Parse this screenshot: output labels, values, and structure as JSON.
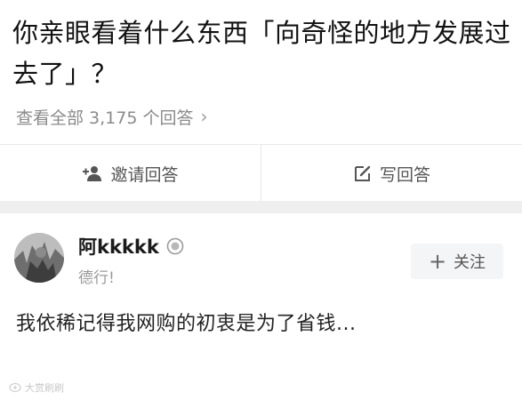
{
  "question": {
    "title": "你亲眼看着什么东西「向奇怪的地方发展过去了」？",
    "all_answers_label": "查看全部 3,175 个回答",
    "chevron": "›"
  },
  "actions": {
    "invite_label": "邀请回答",
    "invite_icon": "person-add-icon",
    "write_label": "写回答",
    "write_icon": "edit-icon"
  },
  "answer": {
    "author_name": "阿kkkkk",
    "author_bio": "德行!",
    "follow_label": "关注",
    "follow_plus": "+",
    "excerpt": "我依稀记得我网购的初衷是为了省钱..."
  },
  "watermark": {
    "text": "大赏刷刷"
  },
  "colors": {
    "title": "#111111",
    "muted": "#8a8a8a",
    "divider_band": "#efefef",
    "follow_bg": "#f4f5f7"
  }
}
